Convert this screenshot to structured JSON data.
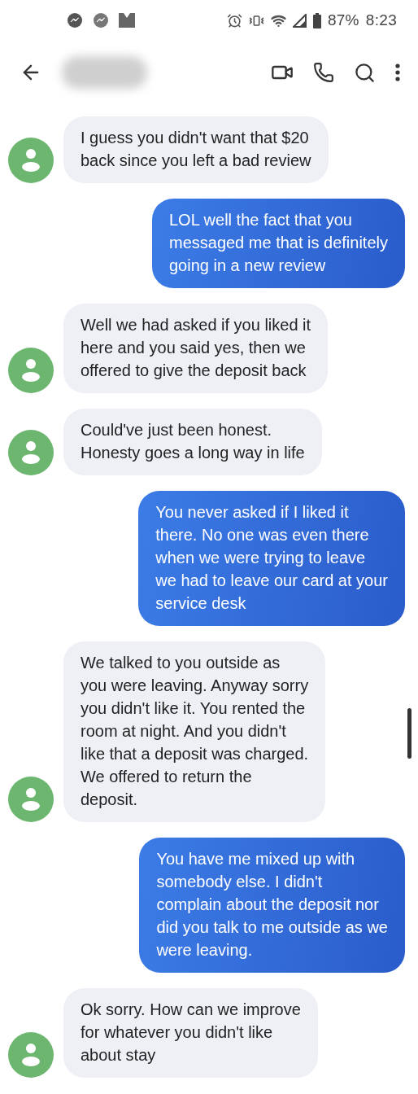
{
  "status_bar": {
    "battery": "87%",
    "time": "8:23"
  },
  "messages": [
    {
      "kind": "incoming",
      "text": "I guess you didn't want that $20\nback since you left a bad review"
    },
    {
      "kind": "outgoing",
      "text": "LOL well the fact that you\nmessaged me that is definitely\ngoing in a new review"
    },
    {
      "kind": "incoming",
      "text": "Well we had asked if you liked it\nhere and you said yes, then we\noffered to give the deposit back"
    },
    {
      "kind": "incoming",
      "text": "Could've just been honest.\nHonesty goes a long way in life"
    },
    {
      "kind": "outgoing",
      "text": "You never asked if I liked it\nthere. No one was even there\nwhen we were trying to leave\nwe had to leave our card at your\nservice desk"
    },
    {
      "kind": "incoming",
      "text": "We talked to you outside as\nyou were leaving. Anyway sorry\nyou didn't like it. You rented the\nroom at night. And you didn't\nlike that a deposit was charged.\nWe offered to return the\ndeposit."
    },
    {
      "kind": "outgoing",
      "text": "You have me mixed up with\nsomebody else. I didn't\ncomplain about the deposit nor\ndid you talk to me outside as we\nwere leaving."
    },
    {
      "kind": "incoming",
      "text": "Ok sorry. How can we improve\nfor whatever you didn't like\nabout stay"
    }
  ]
}
